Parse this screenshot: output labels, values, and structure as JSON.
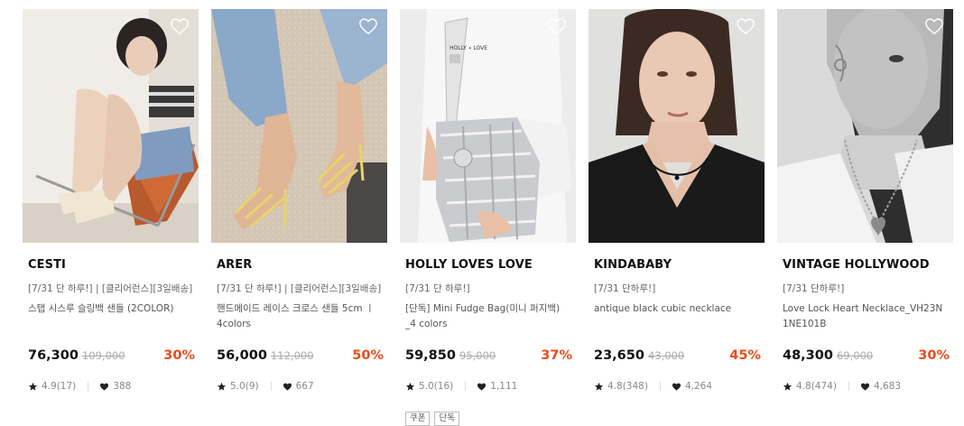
{
  "products": [
    {
      "brand": "CESTI",
      "tag": "[7/31 단 하루!] | [클리어런스][3일배송]",
      "name": "스탭 시스루 슬링백 샌들 (2COLOR)",
      "price": "76,300",
      "original_price": "109,000",
      "discount": "30%",
      "rating": "4.9(17)",
      "likes": "388",
      "badges": [],
      "image": "model seated in chair wearing strap sandals"
    },
    {
      "brand": "ARER",
      "tag": "[7/31 단 하루!] | [클리어런스][3일배송]",
      "name": "핸드메이드 레이스 크로스 샌들 5cm ㅣ 4colors",
      "price": "56,000",
      "original_price": "112,000",
      "discount": "50%",
      "rating": "5.0(9)",
      "likes": "667",
      "badges": [],
      "image": "feet wearing yellow strappy heeled sandals"
    },
    {
      "brand": "HOLLY LOVES LOVE",
      "tag": "[7/31 단 하루!]",
      "name": "[단독] Mini Fudge Bag(미니 퍼지백) _4 colors",
      "price": "59,850",
      "original_price": "95,000",
      "discount": "37%",
      "rating": "5.0(16)",
      "likes": "1,111",
      "badges": [
        "쿠폰",
        "단독"
      ],
      "image": "silver quilted shoulder bag"
    },
    {
      "brand": "KINDABABY",
      "tag": "[7/31 단하루!]",
      "name": "antique black cubic necklace",
      "price": "23,650",
      "original_price": "43,000",
      "discount": "45%",
      "rating": "4.8(348)",
      "likes": "4,264",
      "badges": [],
      "image": "model wearing black choker necklace"
    },
    {
      "brand": "VINTAGE HOLLYWOOD",
      "tag": "[7/31 단하루!]",
      "name": "Love Lock Heart Necklace_VH23N 1NE101B",
      "price": "48,300",
      "original_price": "69,000",
      "discount": "30%",
      "rating": "4.8(474)",
      "likes": "4,683",
      "badges": [],
      "image": "black and white portrait with heart lock necklace"
    }
  ],
  "colors": {
    "discount": "#ec4a1a",
    "price": "#111111",
    "original_price": "#aaaaaa",
    "meta": "#888888"
  }
}
